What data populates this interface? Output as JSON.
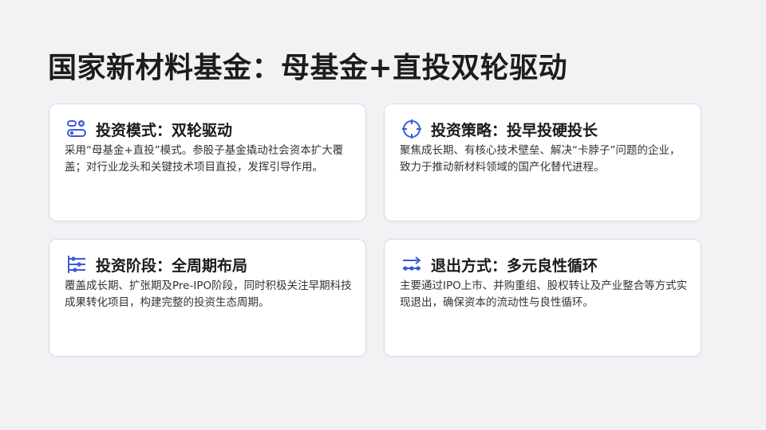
{
  "title": "国家新材料基金：母基金+直投双轮驱动",
  "accent_color": "#3a5bd9",
  "cards": [
    {
      "icon": "mode-toggle-icon",
      "title": "投资模式：双轮驱动",
      "body": "采用“母基金+直投”模式。参股子基金撬动社会资本扩大覆盖；对行业龙头和关键技术项目直投，发挥引导作用。"
    },
    {
      "icon": "target-crosshair-icon",
      "title": "投资策略：投早投硬投长",
      "body": "聚焦成长期、有核心技术壁垒、解决“卡脖子”问题的企业，致力于推动新材料领域的国产化替代进程。"
    },
    {
      "icon": "timeline-stages-icon",
      "title": "投资阶段：全周期布局",
      "body": "覆盖成长期、扩张期及Pre-IPO阶段，同时积极关注早期科技成果转化项目，构建完整的投资生态周期。"
    },
    {
      "icon": "exit-arrows-icon",
      "title": "退出方式：多元良性循环",
      "body": "主要通过IPO上市、并购重组、股权转让及产业整合等方式实现退出，确保资本的流动性与良性循环。"
    }
  ]
}
